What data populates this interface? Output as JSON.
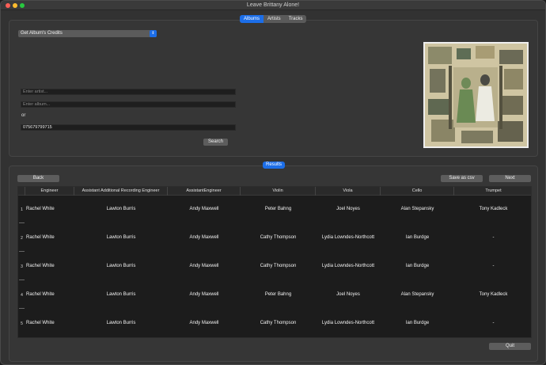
{
  "window": {
    "title": "Leave Brittany Alone!"
  },
  "tabs": [
    {
      "label": "Albums",
      "active": true
    },
    {
      "label": "Artists",
      "active": false
    },
    {
      "label": "Tracks",
      "active": false
    }
  ],
  "query": {
    "mode_selected": "Get Album's Credits",
    "artist_placeholder": "Enter artist...",
    "album_placeholder": "Enter album...",
    "or_label": "or",
    "barcode_value": "075679799715",
    "search_label": "Search"
  },
  "results": {
    "tag_label": "Results",
    "back_label": "Back",
    "save_csv_label": "Save as csv",
    "next_label": "Next",
    "quit_label": "Quit",
    "columns": [
      "Engineer",
      "Assistant Additional Recording Engineer",
      "AssistantEngineer",
      "Violin",
      "Viola",
      "Cello",
      "Trumpet"
    ],
    "rows": [
      {
        "num": "1",
        "cells": [
          "Rachel White",
          "Lawton Burris",
          "Andy Maxwell",
          "Peter Bahng",
          "Joel Noyes",
          "Alan Stepansky",
          "Tony Kadleck"
        ]
      },
      {
        "num": "2",
        "cells": [
          "Rachel White",
          "Lawton Burris",
          "Andy Maxwell",
          "Cathy Thompson",
          "Lydia Lowndes-Northcott",
          "Ian Burdge",
          "-"
        ]
      },
      {
        "num": "3",
        "cells": [
          "Rachel White",
          "Lawton Burris",
          "Andy Maxwell",
          "Cathy Thompson",
          "Lydia Lowndes-Northcott",
          "Ian Burdge",
          "-"
        ]
      },
      {
        "num": "4",
        "cells": [
          "Rachel White",
          "Lawton Burris",
          "Andy Maxwell",
          "Peter Bahng",
          "Joel Noyes",
          "Alan Stepansky",
          "Tony Kadleck"
        ]
      },
      {
        "num": "5",
        "cells": [
          "Rachel White",
          "Lawton Burris",
          "Andy Maxwell",
          "Cathy Thompson",
          "Lydia Lowndes-Northcott",
          "Ian Burdge",
          "-"
        ]
      }
    ]
  },
  "colors": {
    "accent": "#1c6ee8",
    "window_bg": "#323232",
    "table_bg": "#1c1c1c"
  }
}
